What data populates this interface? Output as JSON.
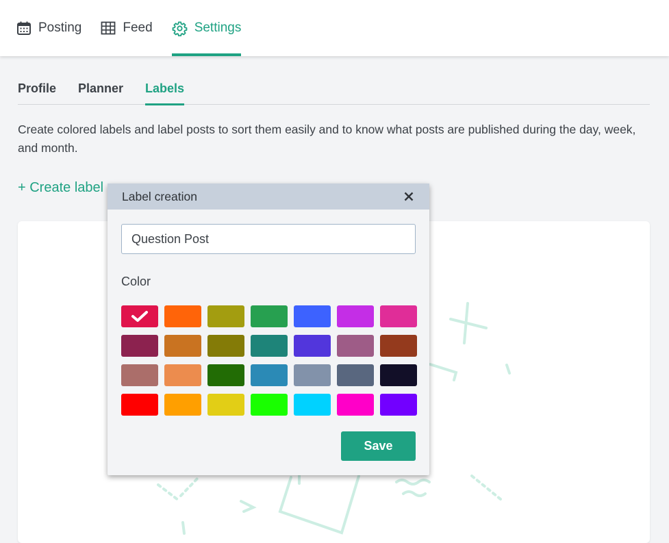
{
  "topnav": {
    "items": [
      {
        "label": "Posting",
        "icon": "calendar-icon",
        "active": false
      },
      {
        "label": "Feed",
        "icon": "grid-icon",
        "active": false
      },
      {
        "label": "Settings",
        "icon": "gear-icon",
        "active": true
      }
    ]
  },
  "subtabs": {
    "items": [
      {
        "label": "Profile",
        "active": false
      },
      {
        "label": "Planner",
        "active": false
      },
      {
        "label": "Labels",
        "active": true
      }
    ]
  },
  "description": "Create colored labels and label posts to sort them easily and to know what posts are published during the day, week, and month.",
  "create_label": "+ Create label",
  "modal": {
    "title": "Label creation",
    "name_value": "Question Post",
    "color_label": "Color",
    "selected_color": "#e0144c",
    "colors": [
      "#e0144c",
      "#ff6409",
      "#a39d10",
      "#27a050",
      "#3d62ff",
      "#c42ee6",
      "#e02d98",
      "#8c224f",
      "#c97321",
      "#847b07",
      "#1e8479",
      "#5236dc",
      "#9e5c87",
      "#943a1d",
      "#ab6e6a",
      "#ec8c4e",
      "#226c05",
      "#2b8ab6",
      "#8292aa",
      "#59677f",
      "#120f28",
      "#ff0000",
      "#ff9f00",
      "#e2ce16",
      "#19ff00",
      "#00d2ff",
      "#ff00c8",
      "#7200ff"
    ],
    "save_label": "Save"
  },
  "colors": {
    "accent": "#1fa283",
    "header_bg": "#c7d0dc",
    "page_bg": "#f3f4f6"
  }
}
